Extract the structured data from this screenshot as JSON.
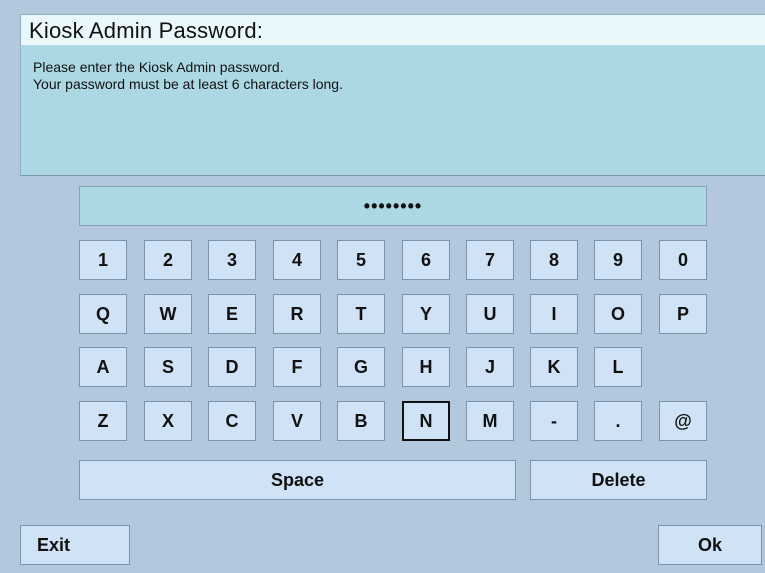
{
  "dialog": {
    "title": "Kiosk Admin Password:",
    "message_lines": [
      "Please enter the Kiosk Admin password.",
      "Your password must be at least 6 characters long."
    ]
  },
  "password_field": {
    "value": "••••••••"
  },
  "keyboard": {
    "rows": [
      [
        "1",
        "2",
        "3",
        "4",
        "5",
        "6",
        "7",
        "8",
        "9",
        "0"
      ],
      [
        "Q",
        "W",
        "E",
        "R",
        "T",
        "Y",
        "U",
        "I",
        "O",
        "P"
      ],
      [
        "A",
        "S",
        "D",
        "F",
        "G",
        "H",
        "J",
        "K",
        "L"
      ],
      [
        "Z",
        "X",
        "C",
        "V",
        "B",
        "N",
        "M",
        "-",
        ".",
        "@"
      ]
    ],
    "focused_key": "N",
    "space_label": "Space",
    "delete_label": "Delete"
  },
  "buttons": {
    "exit_label": "Exit",
    "ok_label": "Ok"
  }
}
